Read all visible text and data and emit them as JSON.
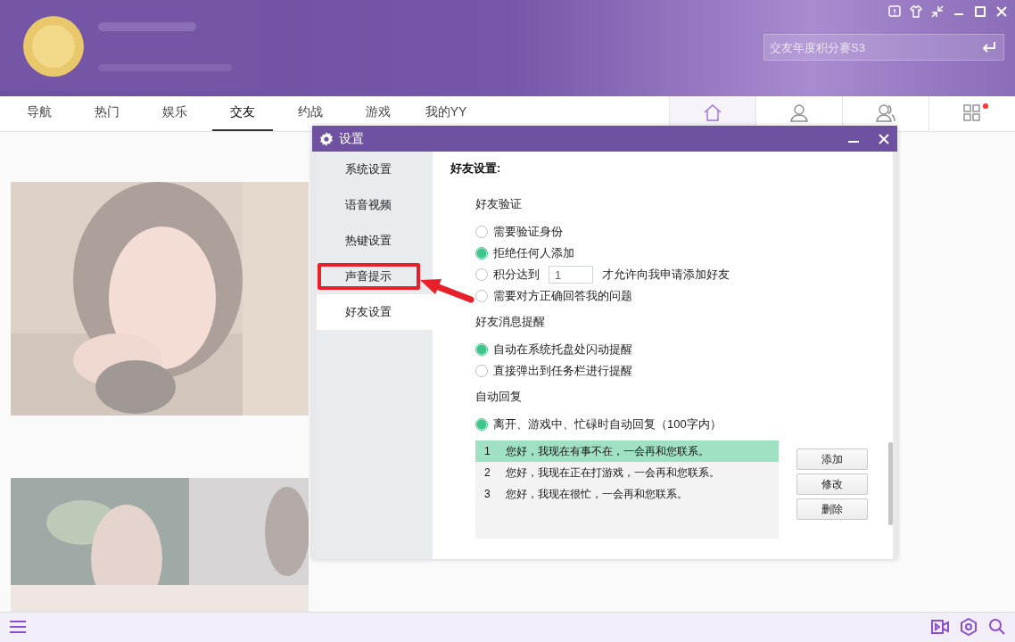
{
  "header": {
    "search": {
      "placeholder": "交友年度积分赛S3"
    }
  },
  "nav": {
    "tabs": [
      {
        "label": "导航",
        "selected": false
      },
      {
        "label": "热门",
        "selected": false
      },
      {
        "label": "娱乐",
        "selected": false
      },
      {
        "label": "交友",
        "selected": true
      },
      {
        "label": "约战",
        "selected": false
      },
      {
        "label": "游戏",
        "selected": false
      },
      {
        "label": "我的YY",
        "selected": false
      }
    ],
    "icons": [
      {
        "kind": "home",
        "selected": true,
        "badge": false
      },
      {
        "kind": "person",
        "selected": false,
        "badge": false
      },
      {
        "kind": "group",
        "selected": false,
        "badge": false
      },
      {
        "kind": "apps",
        "selected": false,
        "badge": true
      }
    ]
  },
  "dialog": {
    "title": "设置",
    "sidebar": {
      "items": [
        {
          "label": "系统设置",
          "selected": false,
          "highlighted": false
        },
        {
          "label": "语音视频",
          "selected": false,
          "highlighted": false
        },
        {
          "label": "热键设置",
          "selected": false,
          "highlighted": false
        },
        {
          "label": "声音提示",
          "selected": false,
          "highlighted": true
        },
        {
          "label": "好友设置",
          "selected": true,
          "highlighted": false
        }
      ]
    },
    "heading": "好友设置:",
    "sections": [
      {
        "title": "好友验证",
        "options": [
          {
            "kind": "plain",
            "label": "需要验证身份",
            "selected": false
          },
          {
            "kind": "plain",
            "label": "拒绝任何人添加",
            "selected": true
          },
          {
            "kind": "points",
            "label": "积分达到",
            "value": "1",
            "suffix": "才允许向我申请添加好友",
            "selected": false
          },
          {
            "kind": "plain",
            "label": "需要对方正确回答我的问题",
            "selected": false
          }
        ]
      },
      {
        "title": "好友消息提醒",
        "options": [
          {
            "kind": "plain",
            "label": "自动在系统托盘处闪动提醒",
            "selected": true
          },
          {
            "kind": "plain",
            "label": "直接弹出到任务栏进行提醒",
            "selected": false
          }
        ]
      },
      {
        "title": "自动回复",
        "options": [
          {
            "kind": "plain",
            "label": "离开、游戏中、忙碌时自动回复（100字内）",
            "selected": true
          }
        ]
      }
    ],
    "replies": [
      {
        "index": "1",
        "text": "您好，我现在有事不在，一会再和您联系。",
        "selected": true
      },
      {
        "index": "2",
        "text": "您好，我现在正在打游戏，一会再和您联系。",
        "selected": false
      },
      {
        "index": "3",
        "text": "您好，我现在很忙，一会再和您联系。",
        "selected": false
      }
    ],
    "buttons": [
      "添加",
      "修改",
      "删除"
    ]
  }
}
